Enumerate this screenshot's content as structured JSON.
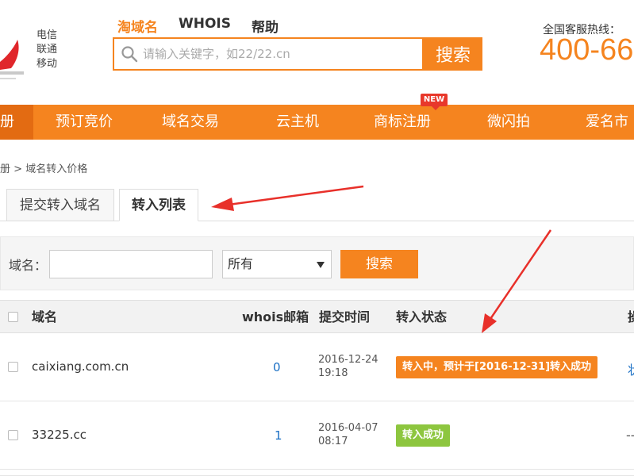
{
  "header": {
    "carriers": [
      "电信",
      "联通",
      "移动"
    ],
    "topnav": [
      "淘域名",
      "WHOIS",
      "帮助"
    ],
    "search_placeholder": "请输入关键字，如22/22.cn",
    "search_button": "搜索",
    "hotline_label": "全国客服热线：",
    "hotline_number": "400-66"
  },
  "mainnav": {
    "items": [
      "册",
      "预订竞价",
      "域名交易",
      "云主机",
      "商标注册",
      "微闪拍",
      "爱名市"
    ],
    "badge": "NEW"
  },
  "breadcrumb": {
    "parent": "册",
    "separator": " > ",
    "current": "域名转入价格"
  },
  "tabs": [
    {
      "label": "提交转入域名",
      "active": false
    },
    {
      "label": "转入列表",
      "active": true
    }
  ],
  "filter": {
    "domain_label": "域名：",
    "domain_value": "",
    "select_value": "所有",
    "search_button": "搜索"
  },
  "table": {
    "columns": [
      "域名",
      "whois邮箱",
      "提交时间",
      "转入状态",
      "操"
    ],
    "rows": [
      {
        "domain": "caixiang.com.cn",
        "whois": "0",
        "date": "2016-12-24",
        "time": "19:18",
        "status": "转入中，预计于[2016-12-31]转入成功",
        "status_type": "pending",
        "op": "状"
      },
      {
        "domain": "33225.cc",
        "whois": "1",
        "date": "2016-04-07",
        "time": "08:17",
        "status": "转入成功",
        "status_type": "ok",
        "op": "--"
      }
    ]
  },
  "colors": {
    "brand_orange": "#f5841f",
    "success_green": "#8dc63f",
    "annotation_red": "#e8302a",
    "link_blue": "#1a6fc4"
  }
}
